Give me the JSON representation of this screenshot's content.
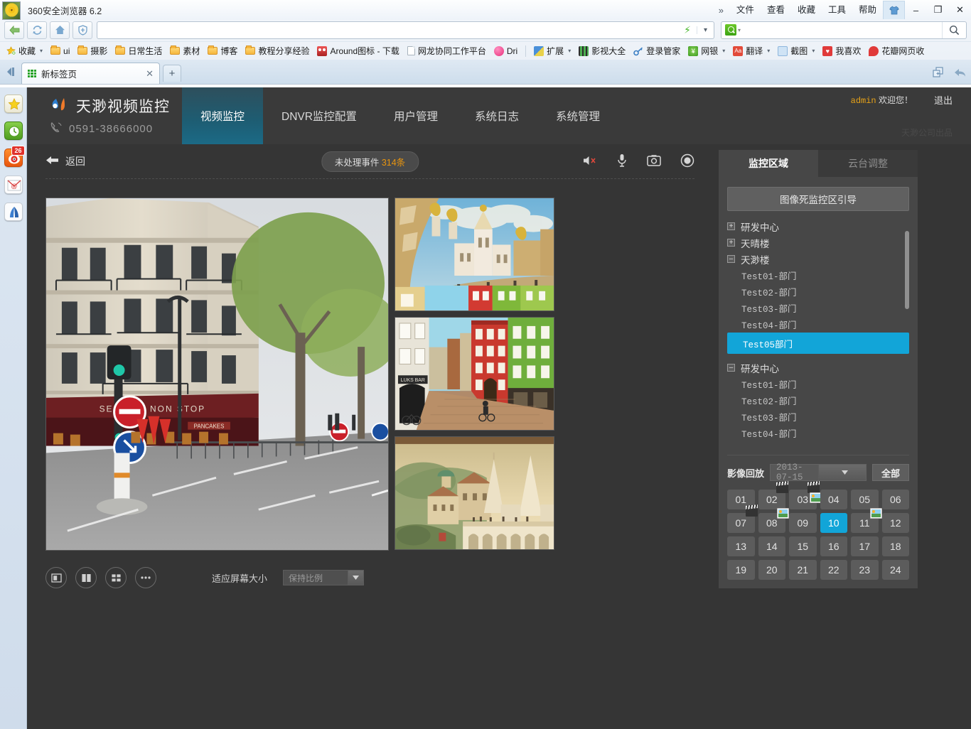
{
  "browser": {
    "window_title": "360安全浏览器 6.2",
    "menus": [
      "文件",
      "查看",
      "收藏",
      "工具",
      "帮助"
    ],
    "overflow_chevron": "»",
    "window_buttons": {
      "theme": "shirt-icon",
      "minimize": "–",
      "maximize": "❐",
      "close": "✕"
    },
    "nav": {
      "back": "back-arrow",
      "refresh": "refresh-icon",
      "home": "home-icon",
      "shield": "shield-icon",
      "address_value": "",
      "address_placeholder": "",
      "lightning": "⚡",
      "dropdown": "▾"
    },
    "search": {
      "value": "",
      "placeholder": "",
      "engine": "360-search-icon",
      "go": "search-icon"
    },
    "bookmarks": {
      "favorites_label": "收藏",
      "items": [
        {
          "label": "ui",
          "icon": "folder-icon"
        },
        {
          "label": "摄影",
          "icon": "folder-icon"
        },
        {
          "label": "日常生活",
          "icon": "folder-icon"
        },
        {
          "label": "素材",
          "icon": "folder-icon"
        },
        {
          "label": "博客",
          "icon": "folder-icon"
        },
        {
          "label": "教程分享经验",
          "icon": "folder-icon"
        },
        {
          "label": "Around图标 - 下载",
          "icon": "site-icon"
        },
        {
          "label": "网龙协同工作平台",
          "icon": "document-icon"
        },
        {
          "label": "Dri",
          "icon": "dribbble-icon"
        }
      ],
      "extensions": [
        {
          "label": "扩展",
          "icon": "extension-icon",
          "caret": true
        },
        {
          "label": "影视大全",
          "icon": "film-icon",
          "caret": false
        },
        {
          "label": "登录管家",
          "icon": "key-icon",
          "caret": false
        },
        {
          "label": "网银",
          "icon": "bank-icon",
          "caret": true
        },
        {
          "label": "翻译",
          "icon": "translate-icon",
          "caret": true
        },
        {
          "label": "截图",
          "icon": "screenshot-icon",
          "caret": true
        },
        {
          "label": "我喜欢",
          "icon": "heart-icon",
          "caret": false
        },
        {
          "label": "花瓣网页收",
          "icon": "huaban-icon",
          "caret": false
        }
      ]
    },
    "tabs": {
      "active_label": "新标签页",
      "close": "✕",
      "new_tab": "+"
    },
    "dock": [
      {
        "name": "favorites-star-icon",
        "badge": null
      },
      {
        "name": "history-clock-icon",
        "badge": null
      },
      {
        "name": "weibo-icon",
        "badge": "26"
      },
      {
        "name": "mail-icon",
        "badge": null
      },
      {
        "name": "app-icon",
        "badge": null
      }
    ]
  },
  "app": {
    "brand": {
      "name": "天渺视频监控",
      "phone": "0591-38666000",
      "logo": "droplet-logo"
    },
    "nav_tabs": [
      {
        "label": "视频监控",
        "active": true
      },
      {
        "label": "DNVR监控配置",
        "active": false
      },
      {
        "label": "用户管理",
        "active": false
      },
      {
        "label": "系统日志",
        "active": false
      },
      {
        "label": "系统管理",
        "active": false
      }
    ],
    "account": {
      "user": "admin",
      "welcome": " 欢迎您！",
      "logout": "退出"
    },
    "footer_brand": "天渺公司出品",
    "toolbar": {
      "back_label": "返回",
      "event_label": "未处理事件",
      "event_count": "314条",
      "icons": [
        "mute-icon",
        "microphone-icon",
        "camera-icon",
        "record-icon"
      ]
    },
    "bottom_toolbar": {
      "buttons": [
        "single-view-icon",
        "split-2-icon",
        "grid-4-icon",
        "more-icon"
      ],
      "fit_label": "适应屏幕大小",
      "ratio_value": "保持比例",
      "ratio_arrow": "▾"
    },
    "videos": [
      {
        "name": "main-stream",
        "caption": ""
      },
      {
        "name": "thumb-1",
        "caption": ""
      },
      {
        "name": "thumb-2",
        "caption": ""
      },
      {
        "name": "thumb-3",
        "caption": ""
      }
    ],
    "right_panel": {
      "tabs": [
        {
          "label": "监控区域",
          "active": true
        },
        {
          "label": "云台调整",
          "active": false
        }
      ],
      "guide_button": "图像死监控区引导",
      "tree": [
        {
          "type": "node",
          "label": "研发中心",
          "expanded": false
        },
        {
          "type": "node",
          "label": "天晴楼",
          "expanded": false
        },
        {
          "type": "node",
          "label": "天渺楼",
          "expanded": true
        },
        {
          "type": "leaf",
          "label": "Test01-部门",
          "selected": false
        },
        {
          "type": "leaf",
          "label": "Test02-部门",
          "selected": false
        },
        {
          "type": "leaf",
          "label": "Test03-部门",
          "selected": false
        },
        {
          "type": "leaf",
          "label": "Test04-部门",
          "selected": false
        },
        {
          "type": "leaf",
          "label": "Test05部门",
          "selected": true
        },
        {
          "type": "node",
          "label": "研发中心",
          "expanded": true
        },
        {
          "type": "leaf",
          "label": "Test01-部门",
          "selected": false
        },
        {
          "type": "leaf",
          "label": "Test02-部门",
          "selected": false
        },
        {
          "type": "leaf",
          "label": "Test03-部门",
          "selected": false
        },
        {
          "type": "leaf",
          "label": "Test04-部门",
          "selected": false
        }
      ],
      "playback": {
        "label": "影像回放",
        "date": "2013-07-15",
        "date_arrow": "▾",
        "all_button": "全部"
      },
      "hours": [
        {
          "label": "01",
          "selected": false,
          "video": false,
          "image": false
        },
        {
          "label": "02",
          "selected": false,
          "video": true,
          "image": false
        },
        {
          "label": "03",
          "selected": false,
          "video": true,
          "image": true
        },
        {
          "label": "04",
          "selected": false,
          "video": false,
          "image": false
        },
        {
          "label": "05",
          "selected": false,
          "video": false,
          "image": false
        },
        {
          "label": "06",
          "selected": false,
          "video": false,
          "image": false
        },
        {
          "label": "07",
          "selected": false,
          "video": true,
          "image": false
        },
        {
          "label": "08",
          "selected": false,
          "video": false,
          "image": true
        },
        {
          "label": "09",
          "selected": false,
          "video": false,
          "image": false
        },
        {
          "label": "10",
          "selected": true,
          "video": false,
          "image": false
        },
        {
          "label": "11",
          "selected": false,
          "video": false,
          "image": true
        },
        {
          "label": "12",
          "selected": false,
          "video": false,
          "image": false
        },
        {
          "label": "13",
          "selected": false,
          "video": false,
          "image": false
        },
        {
          "label": "14",
          "selected": false,
          "video": false,
          "image": false
        },
        {
          "label": "15",
          "selected": false,
          "video": false,
          "image": false
        },
        {
          "label": "16",
          "selected": false,
          "video": false,
          "image": false
        },
        {
          "label": "17",
          "selected": false,
          "video": false,
          "image": false
        },
        {
          "label": "18",
          "selected": false,
          "video": false,
          "image": false
        },
        {
          "label": "19",
          "selected": false,
          "video": false,
          "image": false
        },
        {
          "label": "20",
          "selected": false,
          "video": false,
          "image": false
        },
        {
          "label": "21",
          "selected": false,
          "video": false,
          "image": false
        },
        {
          "label": "22",
          "selected": false,
          "video": false,
          "image": false
        },
        {
          "label": "23",
          "selected": false,
          "video": false,
          "image": false
        },
        {
          "label": "24",
          "selected": false,
          "video": false,
          "image": false
        }
      ]
    }
  },
  "colors": {
    "accent": "#12a5d8",
    "app_bg": "#353535",
    "header_bg": "#3a3a3a",
    "panel_bg": "#474747",
    "orange": "#e8950f"
  }
}
